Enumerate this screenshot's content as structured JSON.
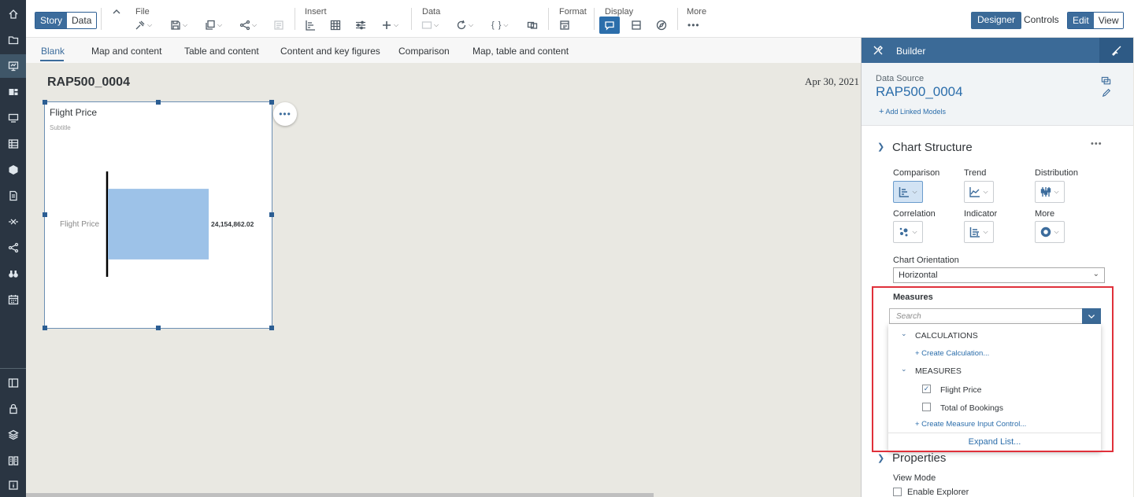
{
  "toolbar": {
    "story_tab": "Story",
    "data_tab": "Data",
    "file_label": "File",
    "insert_label": "Insert",
    "data_label": "Data",
    "format_label": "Format",
    "display_label": "Display",
    "more_label": "More",
    "designer_label": "Designer",
    "controls_label": "Controls",
    "edit_label": "Edit",
    "view_label": "View"
  },
  "templates": [
    "Blank",
    "Map and content",
    "Table and content",
    "Content and key figures",
    "Comparison",
    "Map, table and content"
  ],
  "story": {
    "title": "RAP500_0004",
    "date": "Apr 30, 2021"
  },
  "widget": {
    "title": "Flight Price",
    "subtitle": "Subtitle"
  },
  "chart_data": {
    "type": "bar",
    "orientation": "horizontal",
    "categories": [
      "Flight Price"
    ],
    "values": [
      24154862.02
    ],
    "value_labels": [
      "24,154,862.02"
    ],
    "title": "Flight Price",
    "bar_color": "#9dc2e8"
  },
  "builder": {
    "title": "Builder",
    "data_source_label": "Data Source",
    "data_source_value": "RAP500_0004",
    "add_linked_models": "Add Linked Models",
    "chart_structure_title": "Chart Structure",
    "chart_types": {
      "comparison": "Comparison",
      "trend": "Trend",
      "distribution": "Distribution",
      "correlation": "Correlation",
      "indicator": "Indicator",
      "more": "More"
    },
    "orientation_label": "Chart Orientation",
    "orientation_value": "Horizontal",
    "measures_label": "Measures",
    "search_placeholder": "Search",
    "calculations_group": "CALCULATIONS",
    "create_calculation": "+ Create Calculation...",
    "measures_group": "MEASURES",
    "measures": [
      {
        "label": "Flight Price",
        "checked": true
      },
      {
        "label": "Total of Bookings",
        "checked": false
      }
    ],
    "create_measure_input": "+ Create Measure Input Control...",
    "expand_list": "Expand List...",
    "properties_title": "Properties",
    "view_mode_label": "View Mode",
    "enable_explorer": "Enable Explorer"
  },
  "colors": {
    "shell": "#2a3542",
    "accent": "#3b6a97",
    "highlight": "#e0303a"
  }
}
